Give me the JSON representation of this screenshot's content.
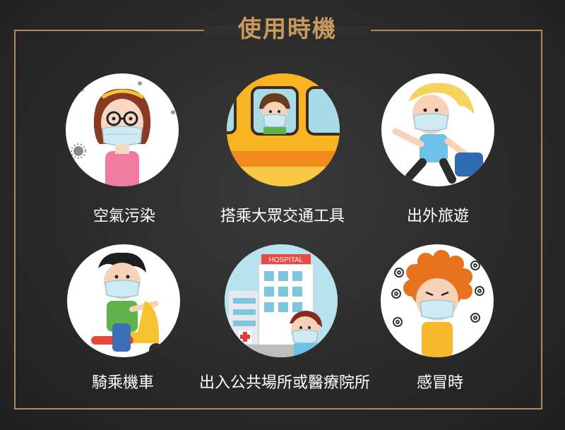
{
  "title": "使用時機",
  "items": [
    {
      "label": "空氣污染",
      "icon": "girl-mask-air-pollution-icon"
    },
    {
      "label": "搭乘大眾交通工具",
      "icon": "bus-passenger-mask-icon"
    },
    {
      "label": "出外旅遊",
      "icon": "traveler-mask-icon"
    },
    {
      "label": "騎乘機車",
      "icon": "scooter-rider-mask-icon"
    },
    {
      "label": "出入公共場所或醫療院所",
      "icon": "hospital-mask-icon",
      "sign": "HOSPITAL"
    },
    {
      "label": "感冒時",
      "icon": "sick-child-mask-icon"
    }
  ],
  "colors": {
    "accent": "#c99a5e",
    "frame": "#b08a58",
    "mask": "#cfeaf3"
  }
}
